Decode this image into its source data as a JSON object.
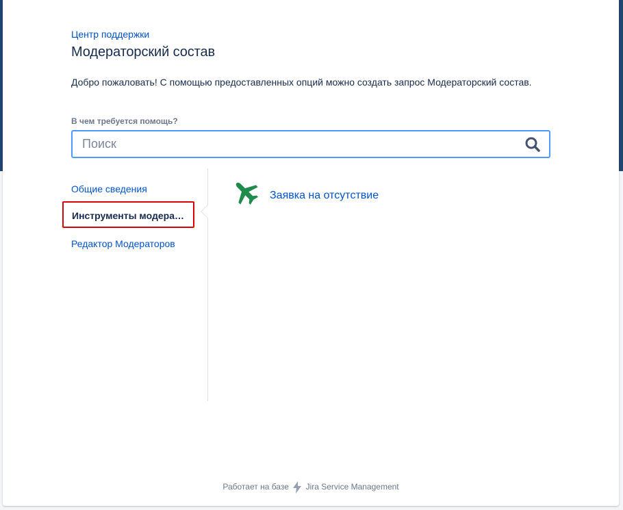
{
  "header": {
    "breadcrumb": "Центр поддержки",
    "title": "Модераторский состав",
    "welcome": "Добро пожаловать! С помощью предоставленных опций можно создать запрос Модераторский состав."
  },
  "search": {
    "label": "В чем требуется помощь?",
    "placeholder": "Поиск",
    "icon": "search-icon"
  },
  "sidebar": {
    "items": [
      {
        "label": "Общие сведения",
        "active": false
      },
      {
        "label": "Инструменты модераторов",
        "active": true
      },
      {
        "label": "Редактор Модераторов",
        "active": false
      }
    ]
  },
  "requests": [
    {
      "label": "Заявка на отсутствие",
      "icon": "airplane-icon",
      "icon_color": "#1f8b4c"
    }
  ],
  "footer": {
    "powered_by": "Работает на базе",
    "product": "Jira Service Management"
  },
  "colors": {
    "header_band": "#21456e",
    "link": "#0052cc",
    "search_border": "#4c9aff",
    "highlight_box": "#de0000"
  }
}
